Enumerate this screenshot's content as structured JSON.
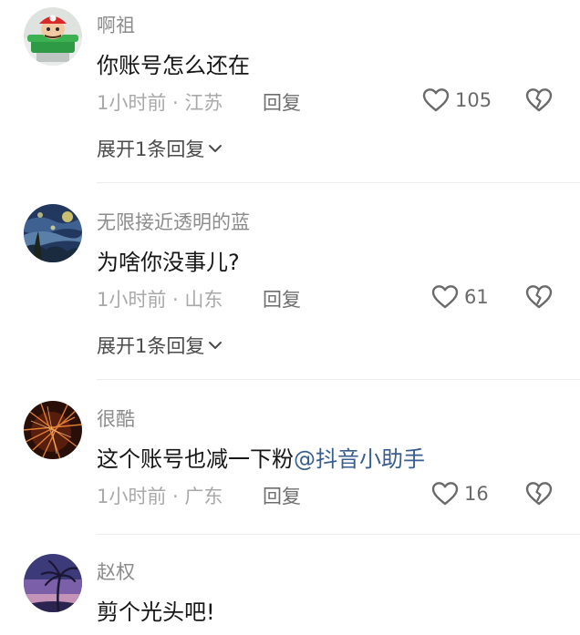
{
  "comments": [
    {
      "username": "啊祖",
      "text": "你账号怎么还在",
      "time_location": "1小时前 · 江苏",
      "reply_label": "回复",
      "likes": "105",
      "expand_label": "展开1条回复",
      "avatar_icon": "mario-avatar-icon"
    },
    {
      "username": "无限接近透明的蓝",
      "text": "为啥你没事儿?",
      "time_location": "1小时前 · 山东",
      "reply_label": "回复",
      "likes": "61",
      "expand_label": "展开1条回复",
      "avatar_icon": "starry-night-avatar-icon"
    },
    {
      "username": "很酷",
      "text": "这个账号也减一下粉",
      "mention": "@抖音小助手",
      "time_location": "1小时前 · 广东",
      "reply_label": "回复",
      "likes": "16",
      "avatar_icon": "sparks-avatar-icon"
    },
    {
      "username": "赵权",
      "text": "剪个光头吧!",
      "avatar_icon": "palm-sunset-avatar-icon"
    }
  ],
  "colors": {
    "username": "#8c8c8c",
    "content": "#161616",
    "meta": "#a9a9a9",
    "mention": "#3a5d8f",
    "divider": "#ececec"
  }
}
